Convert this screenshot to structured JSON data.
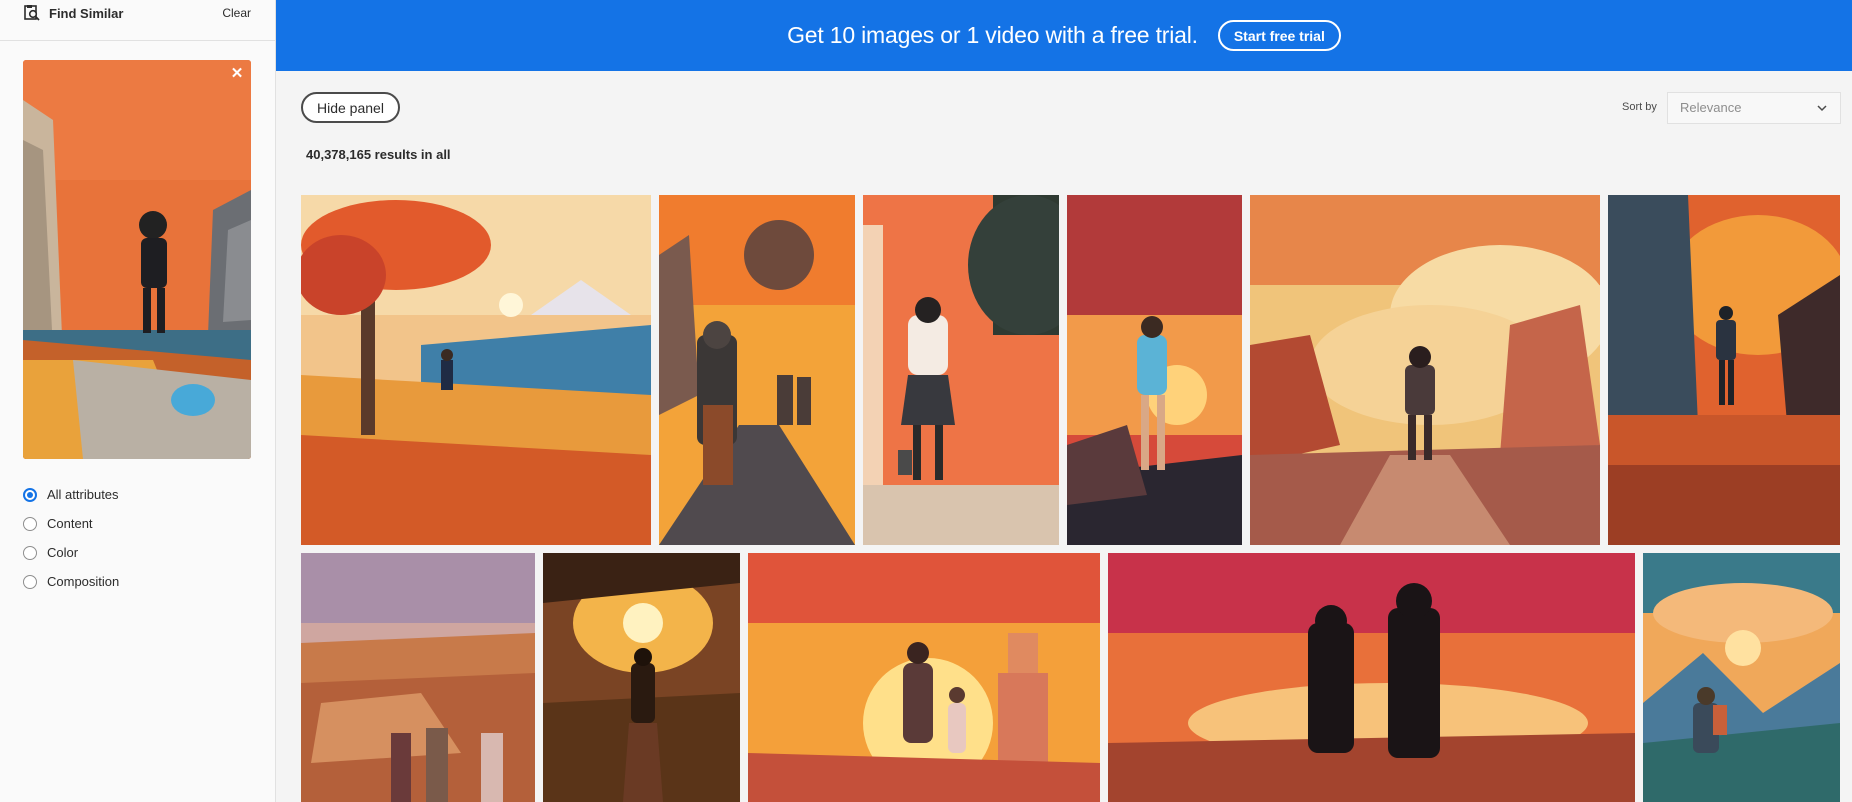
{
  "sidebar": {
    "title": "Find Similar",
    "clear_label": "Clear",
    "attributes": [
      {
        "label": "All attributes",
        "selected": true
      },
      {
        "label": "Content",
        "selected": false
      },
      {
        "label": "Color",
        "selected": false
      },
      {
        "label": "Composition",
        "selected": false
      }
    ]
  },
  "banner": {
    "text": "Get 10 images or 1 video with a free trial.",
    "cta_label": "Start free trial"
  },
  "toolbar": {
    "hide_panel_label": "Hide panel",
    "results_count": "40,378,165 results in all",
    "sort_label": "Sort by",
    "sort_value": "Relevance"
  },
  "colors": {
    "accent": "#1473e6",
    "orange": "#e86a33",
    "sunset": "#f5a23a"
  },
  "icons": {
    "find_similar": "find-similar-icon",
    "close": "close-icon",
    "chevron": "chevron-down-icon"
  }
}
